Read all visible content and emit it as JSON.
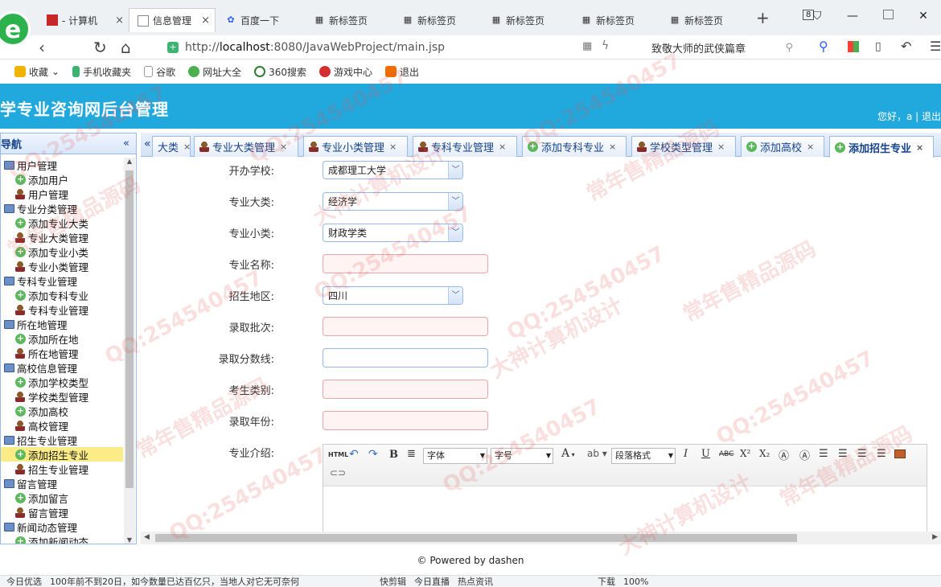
{
  "browser": {
    "tabs": [
      {
        "label": "- 计算机"
      },
      {
        "label": "信息管理"
      },
      {
        "label": "百度一下"
      },
      {
        "label": "新标签页"
      },
      {
        "label": "新标签页"
      },
      {
        "label": "新标签页"
      },
      {
        "label": "新标签页"
      },
      {
        "label": "新标签页"
      }
    ],
    "new_tab": "+",
    "tab_count": "8",
    "url_prefix": "http://",
    "url_host": "localhost",
    "url_rest": ":8080/JavaWebProject/main.jsp",
    "search_text": "致敬大师的武侠篇章",
    "bookmarks": [
      {
        "label": "收藏",
        "color": "#f0b400"
      },
      {
        "label": "手机收藏夹",
        "color": "#3cb371"
      },
      {
        "label": "谷歌",
        "color": "#bbbbbb"
      },
      {
        "label": "网址大全",
        "color": "#4caf50"
      },
      {
        "label": "360搜索",
        "color": "#2e7d32"
      },
      {
        "label": "游戏中心",
        "color": "#d32f2f"
      },
      {
        "label": "退出",
        "color": "#ef6c00"
      }
    ]
  },
  "app": {
    "title": "学专业咨询网后台管理",
    "greeting": "您好，a | 退出"
  },
  "sidebar": {
    "title": "导航",
    "collapse": "«",
    "nodes": [
      {
        "label": "用户管理",
        "type": "grp"
      },
      {
        "label": "添加用户",
        "type": "add"
      },
      {
        "label": "用户管理",
        "type": "user"
      },
      {
        "label": "专业分类管理",
        "type": "grp"
      },
      {
        "label": "添加专业大类",
        "type": "add"
      },
      {
        "label": "专业大类管理",
        "type": "user"
      },
      {
        "label": "添加专业小类",
        "type": "add"
      },
      {
        "label": "专业小类管理",
        "type": "user"
      },
      {
        "label": "专科专业管理",
        "type": "grp"
      },
      {
        "label": "添加专科专业",
        "type": "add"
      },
      {
        "label": "专科专业管理",
        "type": "user"
      },
      {
        "label": "所在地管理",
        "type": "grp"
      },
      {
        "label": "添加所在地",
        "type": "add"
      },
      {
        "label": "所在地管理",
        "type": "user"
      },
      {
        "label": "高校信息管理",
        "type": "grp"
      },
      {
        "label": "添加学校类型",
        "type": "add"
      },
      {
        "label": "学校类型管理",
        "type": "user"
      },
      {
        "label": "添加高校",
        "type": "add"
      },
      {
        "label": "高校管理",
        "type": "user"
      },
      {
        "label": "招生专业管理",
        "type": "grp"
      },
      {
        "label": "添加招生专业",
        "type": "add",
        "selected": true
      },
      {
        "label": "招生专业管理",
        "type": "user"
      },
      {
        "label": "留言管理",
        "type": "grp"
      },
      {
        "label": "添加留言",
        "type": "add"
      },
      {
        "label": "留言管理",
        "type": "user"
      },
      {
        "label": "新闻动态管理",
        "type": "grp"
      },
      {
        "label": "添加新闻动态",
        "type": "add"
      }
    ]
  },
  "content_tabs": {
    "scroll_left": "«",
    "items": [
      {
        "label": "大类",
        "icon": ""
      },
      {
        "label": "专业大类管理",
        "icon": "user"
      },
      {
        "label": "专业小类管理",
        "icon": "user"
      },
      {
        "label": "专科专业管理",
        "icon": "user"
      },
      {
        "label": "添加专科专业",
        "icon": "add"
      },
      {
        "label": "学校类型管理",
        "icon": "user"
      },
      {
        "label": "添加高校",
        "icon": "add"
      },
      {
        "label": "添加招生专业",
        "icon": "add",
        "active": true
      }
    ],
    "close": "×"
  },
  "form": {
    "school": {
      "label": "开办学校:",
      "value": "成都理工大学"
    },
    "major_big": {
      "label": "专业大类:",
      "value": "经济学"
    },
    "major_small": {
      "label": "专业小类:",
      "value": "财政学类"
    },
    "major_name": {
      "label": "专业名称:",
      "value": ""
    },
    "region": {
      "label": "招生地区:",
      "value": "四川"
    },
    "batch": {
      "label": "录取批次:",
      "value": ""
    },
    "score": {
      "label": "录取分数线:",
      "value": ""
    },
    "student_type": {
      "label": "考生类别:",
      "value": ""
    },
    "year": {
      "label": "录取年份:",
      "value": ""
    },
    "intro": {
      "label": "专业介绍:"
    }
  },
  "editor": {
    "html": "HTML",
    "font_family": "字体",
    "font_size": "字号",
    "paragraph": "段落格式",
    "bold": "B",
    "italic": "I",
    "underline": "U",
    "strike": "ABC",
    "sup": "X²",
    "sub": "X₂",
    "font_color": "A"
  },
  "footer": "© Powered by dashen",
  "statusbar": {
    "items": [
      "今日优选",
      "100年前不到20日，如今数量已达百亿只，当地人对它无可奈何",
      "快剪辑",
      "今日直播",
      "热点资讯",
      "下载",
      "100%"
    ]
  },
  "watermarks": [
    "QQ:254540457",
    "大神计算机设计",
    "常年售精品源码"
  ]
}
